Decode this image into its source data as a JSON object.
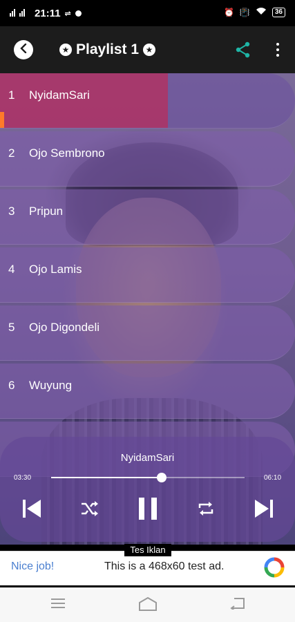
{
  "status_bar": {
    "time": "21:11",
    "battery": "36"
  },
  "app_bar": {
    "title": "Playlist 1"
  },
  "tracks": [
    {
      "number": "1",
      "name": "NyidamSari"
    },
    {
      "number": "2",
      "name": "Ojo Sembrono"
    },
    {
      "number": "3",
      "name": "Pripun"
    },
    {
      "number": "4",
      "name": "Ojo Lamis"
    },
    {
      "number": "5",
      "name": "Ojo Digondeli"
    },
    {
      "number": "6",
      "name": "Wuyung"
    }
  ],
  "active_track_progress": 0.57,
  "player": {
    "now_playing": "NyidamSari",
    "elapsed": "03:30",
    "duration": "06:10",
    "seek_progress": 0.57
  },
  "ad": {
    "label": "Tes Iklan",
    "headline": "Nice job!",
    "text": "This is a 468x60 test ad."
  },
  "colors": {
    "accent_share": "#1fb5a6",
    "progress": "#d21e46",
    "ad_headline": "#4a7fd0"
  }
}
